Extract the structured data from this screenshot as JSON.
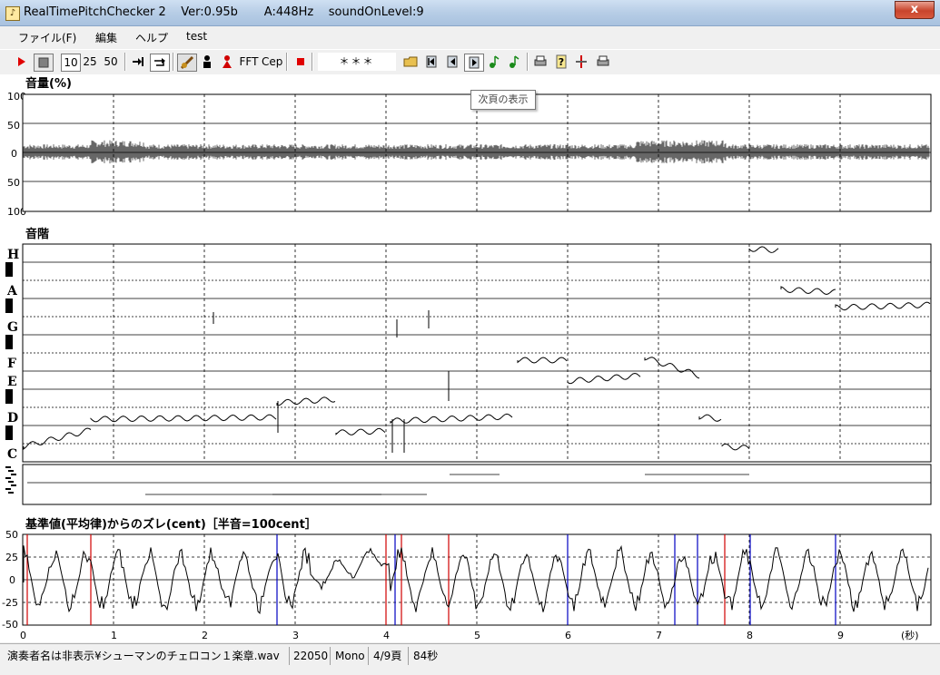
{
  "window": {
    "title": "RealTimePitchChecker 2    Ver:0.95b       A:448Hz    soundOnLevel:9",
    "close_label": "x"
  },
  "menu": {
    "items": [
      {
        "label": "ファイル(F)"
      },
      {
        "label": "編集"
      },
      {
        "label": "ヘルプ"
      },
      {
        "label": "test"
      }
    ]
  },
  "toolbar": {
    "zoom_10": "10",
    "zoom_25": "25",
    "zoom_50": "50",
    "fft_label": "FFT",
    "cep_label": "Cep",
    "display_value": "＊＊＊",
    "tooltip": "次頁の表示"
  },
  "volume_panel": {
    "title": "音量(%)",
    "y_labels": [
      "100",
      "50",
      "0",
      "50",
      "100"
    ]
  },
  "scale_panel": {
    "title": "音階",
    "notes": [
      "H",
      "A",
      "G",
      "F",
      "E",
      "D",
      "C"
    ]
  },
  "deviation_panel": {
    "title": "基準値(平均律)からのズレ(cent)［半音=100cent］",
    "y_labels": [
      "50",
      "25",
      "0",
      "-25",
      "-50"
    ]
  },
  "time_axis": {
    "ticks": [
      "0",
      "1",
      "2",
      "3",
      "4",
      "5",
      "6",
      "7",
      "8",
      "9"
    ],
    "unit": "(秒)"
  },
  "status": {
    "file": "演奏者名は非表示¥シューマンのチェロコン１楽章.wav",
    "sample_rate": "22050",
    "channels": "Mono",
    "page": "4/9頁",
    "duration": "84秒"
  },
  "colors": {
    "record": "#e00000",
    "stop_square": "#d00000",
    "note_green": "#1a8a1a",
    "deviation_red": "#d00000",
    "deviation_blue": "#0000c0"
  },
  "icons": [
    "play-icon",
    "stop-icon",
    "skip-icon",
    "loop-icon",
    "violin-icon",
    "person-icon",
    "person-red-icon",
    "record-icon",
    "folder-icon",
    "first-page-icon",
    "prev-page-icon",
    "next-page-icon",
    "note-icon",
    "print-icon",
    "help-icon",
    "marker-icon",
    "print2-icon"
  ]
}
